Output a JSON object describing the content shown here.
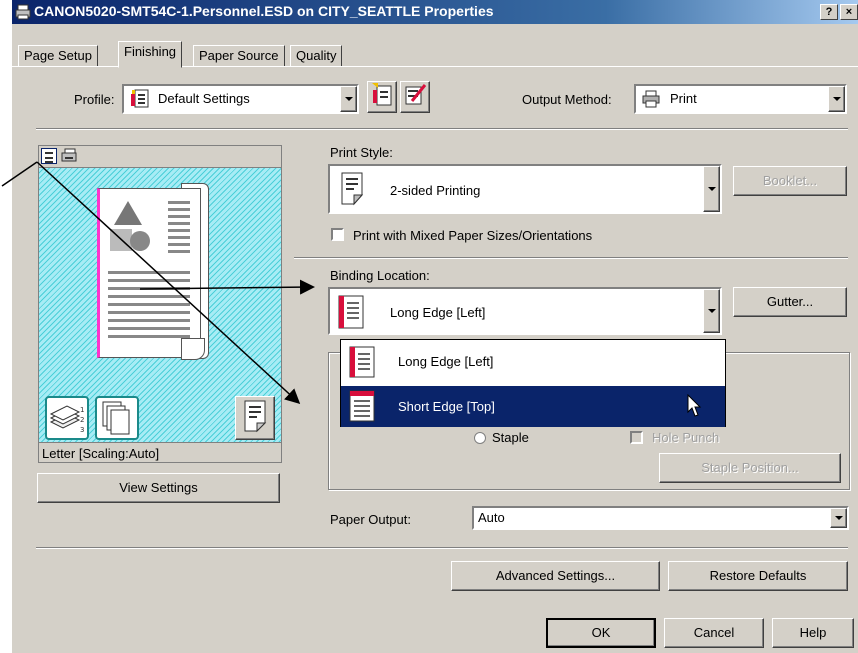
{
  "window": {
    "title": "CANON5020-SMT54C-1.Personnel.ESD on CITY_SEATTLE Properties",
    "help_glyph": "?",
    "close_glyph": "×",
    "icon": "printer-icon"
  },
  "tabs": [
    {
      "label": "Page Setup",
      "active": false
    },
    {
      "label": "Finishing",
      "active": true
    },
    {
      "label": "Paper Source",
      "active": false
    },
    {
      "label": "Quality",
      "active": false
    }
  ],
  "profile": {
    "label": "Profile:",
    "value": "Default Settings",
    "icon": "profile-icon"
  },
  "output_method": {
    "label": "Output Method:",
    "value": "Print",
    "icon": "printer-icon"
  },
  "preview": {
    "paper_info": "Letter [Scaling:Auto]",
    "view_settings_label": "View Settings",
    "stripe_color": "#4bcfd8",
    "accent_color": "#ff33cc"
  },
  "print_style": {
    "label": "Print Style:",
    "value": "2-sided Printing",
    "booklet_label": "Booklet..."
  },
  "mixed_paper": {
    "label": "Print with Mixed Paper Sizes/Orientations",
    "checked": false
  },
  "binding": {
    "label": "Binding Location:",
    "value": "Long Edge [Left]",
    "gutter_label": "Gutter...",
    "options": [
      {
        "label": "Long Edge [Left]",
        "selected": false
      },
      {
        "label": "Short Edge [Top]",
        "selected": true
      }
    ],
    "highlight_color": "#0a246a"
  },
  "finishing": {
    "staple_label": "Staple",
    "hole_punch_label": "Hole Punch",
    "staple_position_label": "Staple Position..."
  },
  "paper_output": {
    "label": "Paper Output:",
    "value": "Auto"
  },
  "buttons": {
    "advanced": "Advanced Settings...",
    "restore": "Restore Defaults",
    "ok": "OK",
    "cancel": "Cancel",
    "help": "Help"
  }
}
